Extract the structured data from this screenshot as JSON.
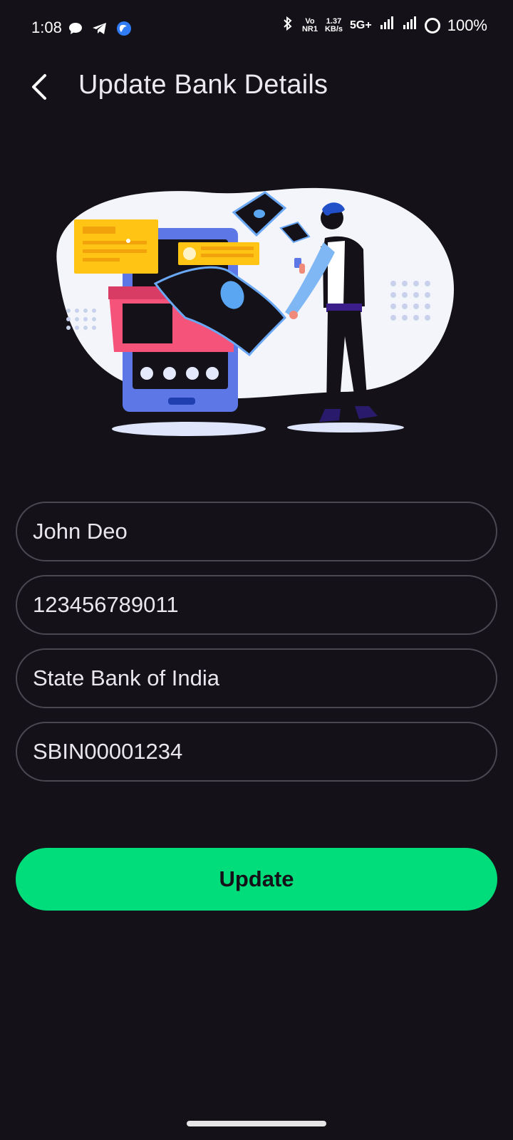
{
  "status_bar": {
    "time": "1:08",
    "net_volte": "Vo",
    "net_nr": "NR1",
    "speed_value": "1.37",
    "speed_unit": "KB/s",
    "network": "5G+",
    "battery": "100%"
  },
  "header": {
    "title": "Update Bank Details",
    "back_icon": "chevron-left-icon"
  },
  "form": {
    "fields": [
      {
        "value": "John Deo"
      },
      {
        "value": "123456789011"
      },
      {
        "value": "State Bank of India"
      },
      {
        "value": "SBIN00001234"
      }
    ]
  },
  "actions": {
    "update_label": "Update"
  },
  "colors": {
    "background": "#141218",
    "accent": "#00dd7a",
    "field_border": "#4a4750"
  }
}
